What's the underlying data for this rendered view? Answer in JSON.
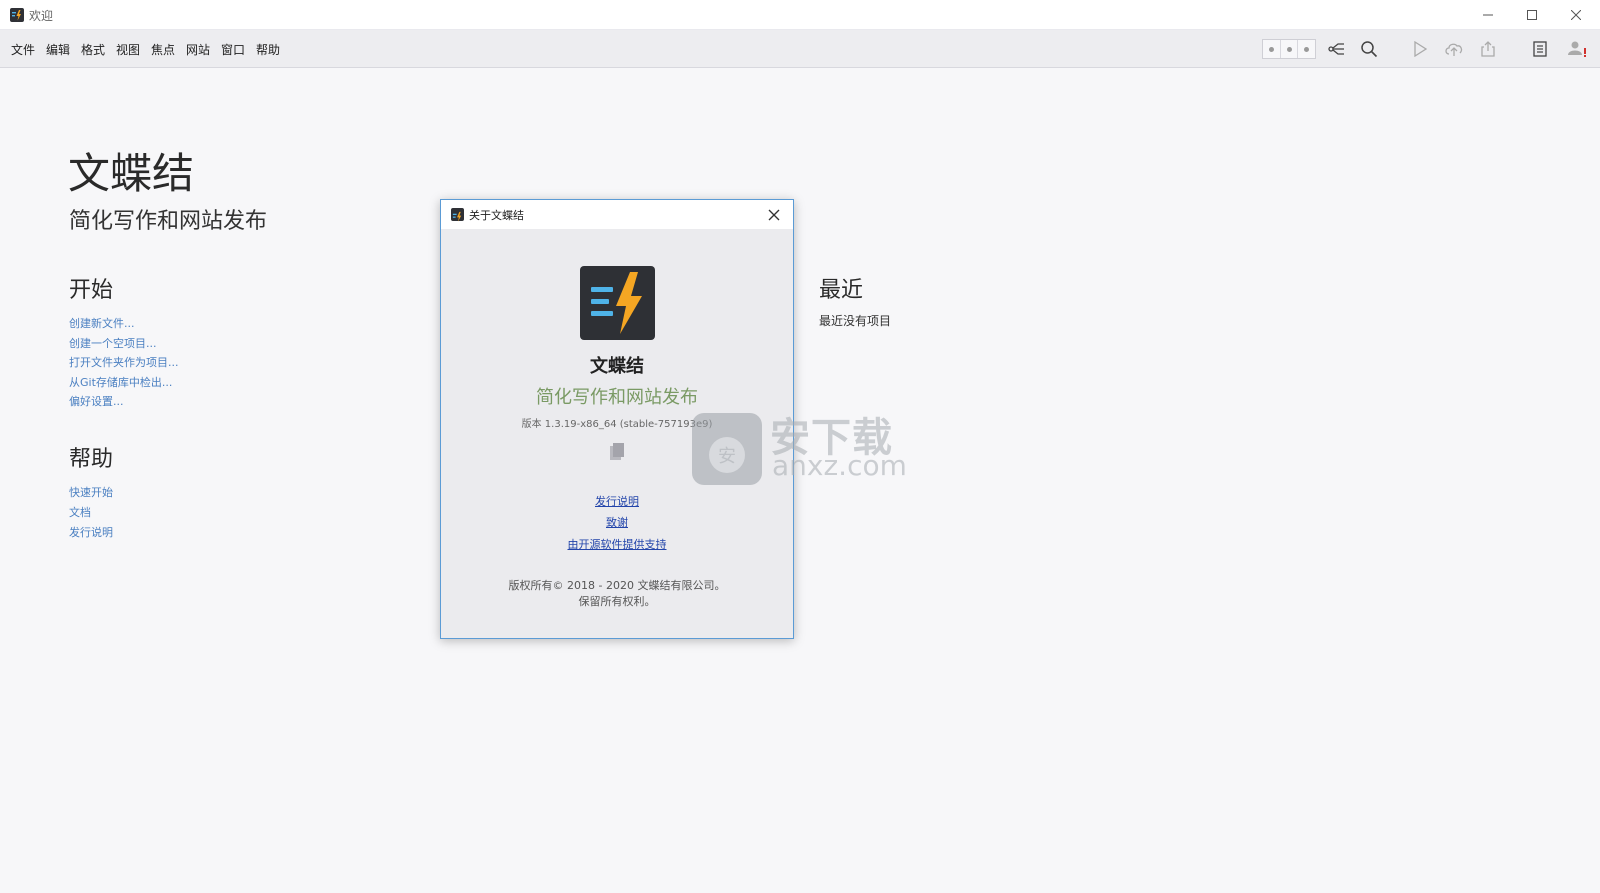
{
  "window": {
    "title": "欢迎"
  },
  "menu": {
    "items": [
      "文件",
      "编辑",
      "格式",
      "视图",
      "焦点",
      "网站",
      "窗口",
      "帮助"
    ]
  },
  "toolbar": {
    "icons": [
      "view-switch-icon",
      "share-tree-icon",
      "search-icon",
      "play-icon",
      "upload-icon",
      "export-icon",
      "sidebar-icon",
      "account-icon"
    ],
    "account_alert": "!"
  },
  "welcome": {
    "title": "文蝶结",
    "subtitle": "简化写作和网站发布",
    "start": {
      "heading": "开始",
      "links": [
        "创建新文件...",
        "创建一个空项目...",
        "打开文件夹作为项目...",
        "从Git存储库中检出...",
        "偏好设置..."
      ]
    },
    "help": {
      "heading": "帮助",
      "links": [
        "快速开始",
        "文档",
        "发行说明"
      ]
    },
    "recent": {
      "heading": "最近",
      "empty_text": "最近没有项目"
    }
  },
  "about_dialog": {
    "title": "关于文蝶结",
    "app_name": "文蝶结",
    "tagline": "简化写作和网站发布",
    "version": "版本 1.3.19-x86_64 (stable-757193e9)",
    "links": {
      "release_notes": "发行说明",
      "thanks": "致谢",
      "open_source": "由开源软件提供支持"
    },
    "copyright_line1": "版权所有© 2018 - 2020 文蝶结有限公司。",
    "copyright_line2": "保留所有权利。",
    "colors": {
      "tagline": "#7a9a64",
      "link": "#2244aa",
      "border": "#5b9bd5"
    }
  },
  "watermark": {
    "cn": "安下载",
    "en": "anxz.com",
    "bag_char": "安"
  },
  "colors": {
    "accent_link": "#4a7fc1",
    "logo_bolt": "#f5a623",
    "logo_lines": "#4fb3e8"
  }
}
